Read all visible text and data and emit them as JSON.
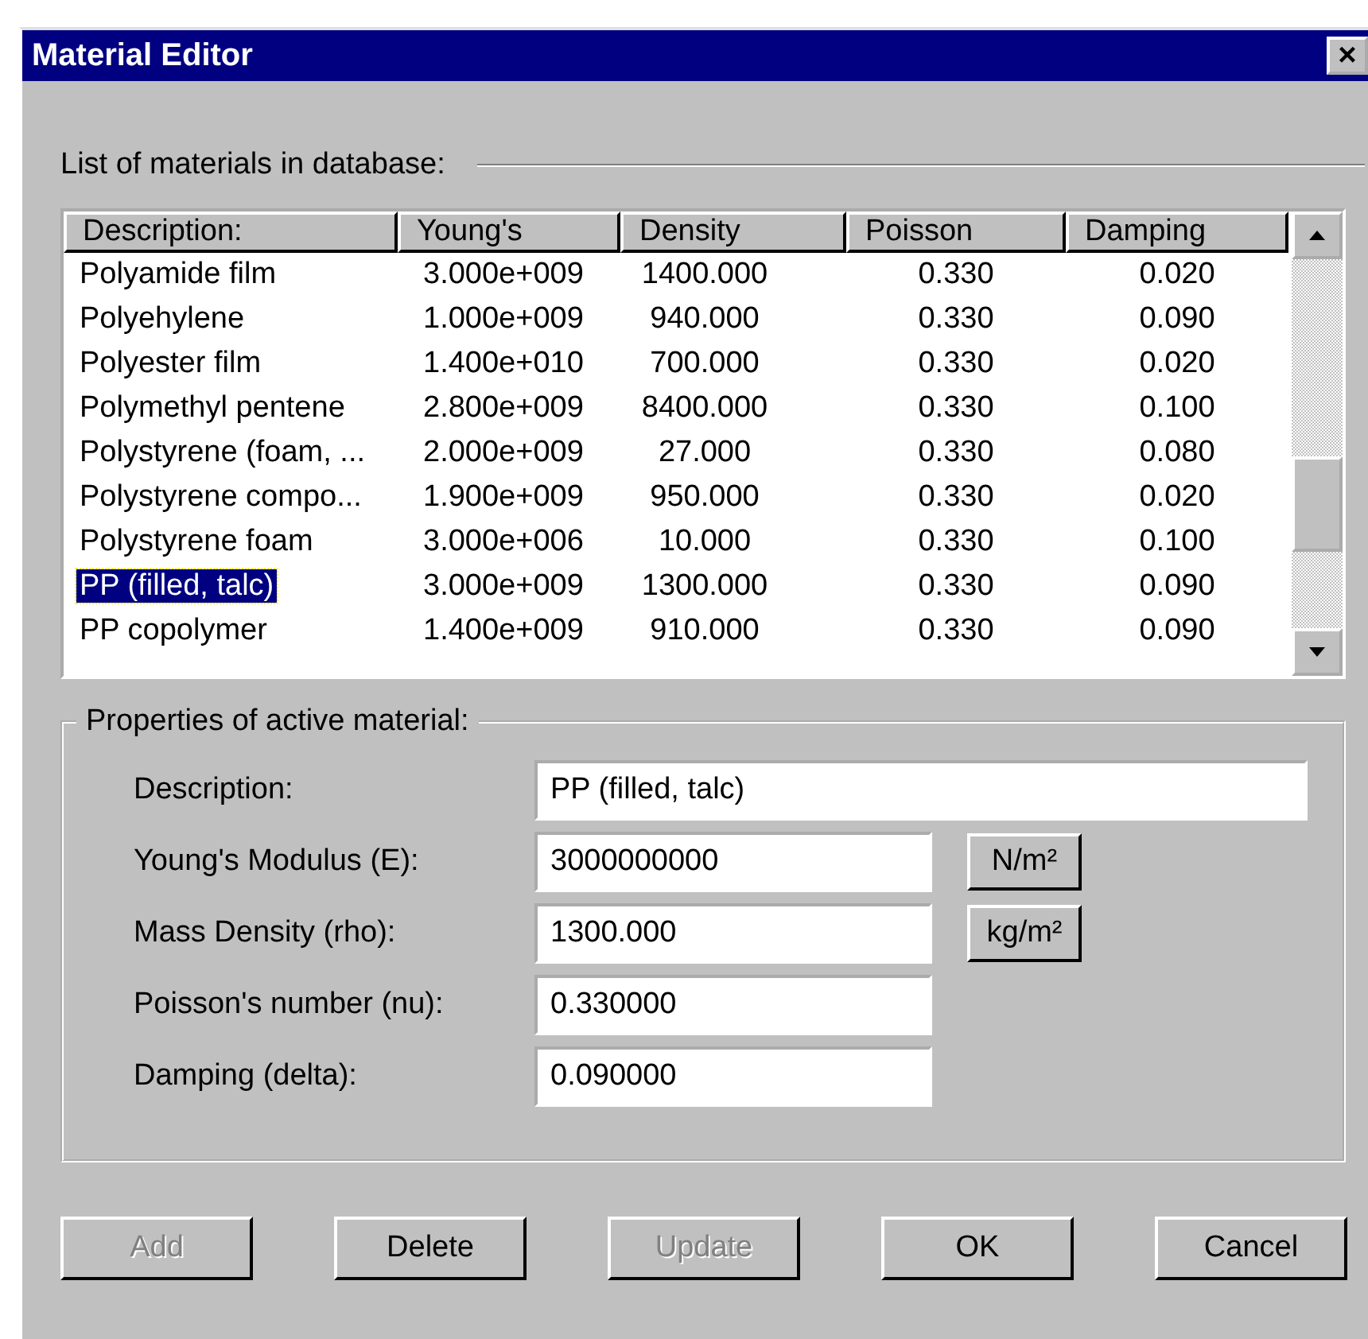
{
  "window": {
    "title": "Material Editor",
    "close": "×"
  },
  "list_label": "List of materials in database:",
  "table": {
    "columns": [
      "Description:",
      "Young's",
      "Density",
      "Poisson",
      "Damping"
    ],
    "rows": [
      {
        "cells": [
          "Polyamide film",
          "3.000e+009",
          "1400.000",
          "0.330",
          "0.020"
        ],
        "selected": false
      },
      {
        "cells": [
          "Polyehylene",
          "1.000e+009",
          "940.000",
          "0.330",
          "0.090"
        ],
        "selected": false
      },
      {
        "cells": [
          "Polyester film",
          "1.400e+010",
          "700.000",
          "0.330",
          "0.020"
        ],
        "selected": false
      },
      {
        "cells": [
          "Polymethyl pentene",
          "2.800e+009",
          "8400.000",
          "0.330",
          "0.100"
        ],
        "selected": false
      },
      {
        "cells": [
          "Polystyrene (foam, ...",
          "2.000e+009",
          "27.000",
          "0.330",
          "0.080"
        ],
        "selected": false
      },
      {
        "cells": [
          "Polystyrene compo...",
          "1.900e+009",
          "950.000",
          "0.330",
          "0.020"
        ],
        "selected": false
      },
      {
        "cells": [
          "Polystyrene foam",
          "3.000e+006",
          "10.000",
          "0.330",
          "0.100"
        ],
        "selected": false
      },
      {
        "cells": [
          "PP (filled, talc)",
          "3.000e+009",
          "1300.000",
          "0.330",
          "0.090"
        ],
        "selected": true
      },
      {
        "cells": [
          "PP copolymer",
          "1.400e+009",
          "910.000",
          "0.330",
          "0.090"
        ],
        "selected": false
      }
    ]
  },
  "properties": {
    "title": "Properties of active material:",
    "fields": [
      {
        "label": "Description:",
        "value": "PP (filled, talc)",
        "kind": "wide"
      },
      {
        "label": "Young's Modulus (E):",
        "value": "3000000000",
        "kind": "unit",
        "unit": "N/m²"
      },
      {
        "label": "Mass Density (rho):",
        "value": "1300.000",
        "kind": "unit",
        "unit": "kg/m²"
      },
      {
        "label": "Poisson's number (nu):",
        "value": "0.330000",
        "kind": "plain"
      },
      {
        "label": "Damping (delta):",
        "value": "0.090000",
        "kind": "plain"
      }
    ]
  },
  "buttons": [
    {
      "label": "Add",
      "disabled": true
    },
    {
      "label": "Delete",
      "disabled": false
    },
    {
      "label": "Update",
      "disabled": true
    },
    {
      "label": "OK",
      "disabled": false
    },
    {
      "label": "Cancel",
      "disabled": false
    }
  ]
}
